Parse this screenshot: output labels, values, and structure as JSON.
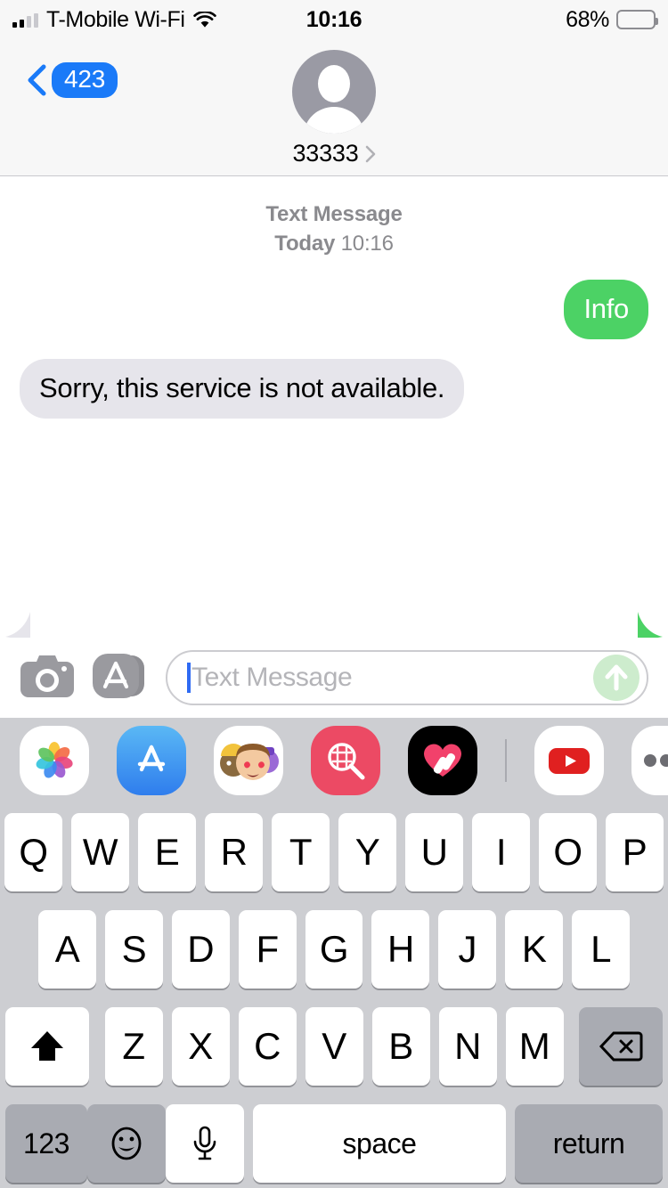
{
  "status_bar": {
    "carrier": "T-Mobile Wi-Fi",
    "signal_bars_filled": 2,
    "signal_bars_total": 4,
    "wifi_icon": "wifi-icon",
    "time": "10:16",
    "battery_percent": "68%",
    "battery_level": 68
  },
  "navbar": {
    "back_label": "423",
    "back_icon": "chevron-left-icon",
    "avatar_icon": "person-placeholder-avatar",
    "peer_name": "33333",
    "detail_icon": "chevron-right-icon"
  },
  "thread": {
    "divider": {
      "service": "Text Message",
      "day": "Today",
      "time": "10:16"
    },
    "messages": [
      {
        "id": "msg-1",
        "direction": "outgoing",
        "kind": "sms",
        "text": "Info"
      },
      {
        "id": "msg-2",
        "direction": "incoming",
        "kind": "sms",
        "text": "Sorry, this service is not available."
      }
    ]
  },
  "input_bar": {
    "camera_icon": "camera-icon",
    "appstore_icon": "app-store-icon",
    "placeholder": "Text Message",
    "value": "",
    "send_icon": "send-arrow-up-icon",
    "send_enabled": false
  },
  "app_drawer": {
    "apps": [
      {
        "id": "photos",
        "name": "photos-app-icon"
      },
      {
        "id": "appstore",
        "name": "app-store-app-icon"
      },
      {
        "id": "memoji",
        "name": "memoji-stickers-app-icon"
      },
      {
        "id": "images",
        "name": "images-search-app-icon"
      },
      {
        "id": "health",
        "name": "heart-bandage-app-icon"
      },
      {
        "id": "youtube",
        "name": "youtube-app-icon"
      },
      {
        "id": "more",
        "name": "more-dots-app-icon"
      }
    ]
  },
  "keyboard": {
    "row1": [
      "Q",
      "W",
      "E",
      "R",
      "T",
      "Y",
      "U",
      "I",
      "O",
      "P"
    ],
    "row2": [
      "A",
      "S",
      "D",
      "F",
      "G",
      "H",
      "J",
      "K",
      "L"
    ],
    "row3_letters": [
      "Z",
      "X",
      "C",
      "V",
      "B",
      "N",
      "M"
    ],
    "shift_icon": "shift-up-arrow-icon",
    "backspace_icon": "backspace-delete-icon",
    "numbers_label": "123",
    "emoji_icon": "emoji-smiley-icon",
    "dictation_icon": "microphone-icon",
    "space_label": "space",
    "return_label": "return"
  },
  "colors": {
    "sms_green": "#4cd265",
    "received_gray": "#e6e5eb",
    "ios_blue": "#1a7af8",
    "keyboard_bg": "#cdced2",
    "chrome_bg": "#f7f7f7"
  }
}
